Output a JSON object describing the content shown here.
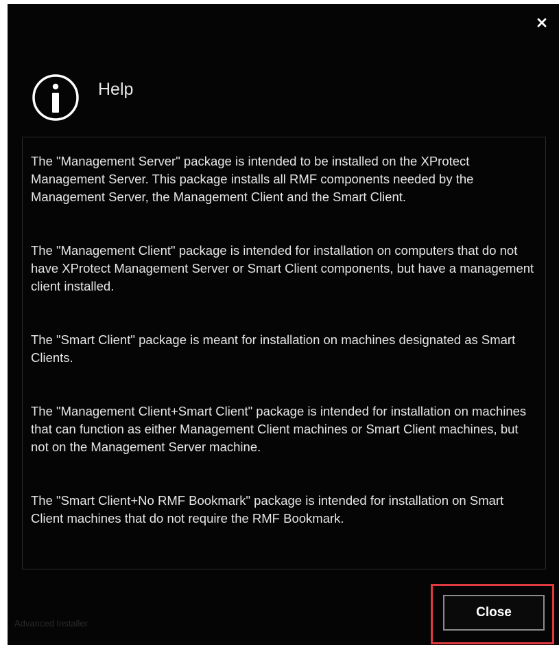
{
  "dialog": {
    "title": "Help",
    "close_icon": "close-x-icon",
    "header_icon": "info-circle-icon",
    "paragraphs": [
      "The \"Management Server\" package is intended to be installed on the XProtect Management Server. This package installs all RMF components needed by the Management Server, the Management Client and the Smart Client.",
      "The \"Management Client\" package is intended for installation on computers that do not have XProtect Management Server or Smart Client components, but have a management client installed.",
      "The \"Smart Client\" package is meant for installation on machines designated as Smart Clients.",
      "The \"Management Client+Smart Client\" package is intended for installation on machines that can function as either Management Client machines or Smart Client machines, but not on the Management Server machine.",
      "The \"Smart Client+No RMF Bookmark\" package is intended for installation on Smart Client machines that do not require the RMF Bookmark."
    ],
    "close_button_label": "Close",
    "brand_text": "Advanced Installer"
  },
  "colors": {
    "background": "#050505",
    "text": "#e6e6e6",
    "highlight": "#e0393e",
    "button_border": "#8c8c8c"
  }
}
